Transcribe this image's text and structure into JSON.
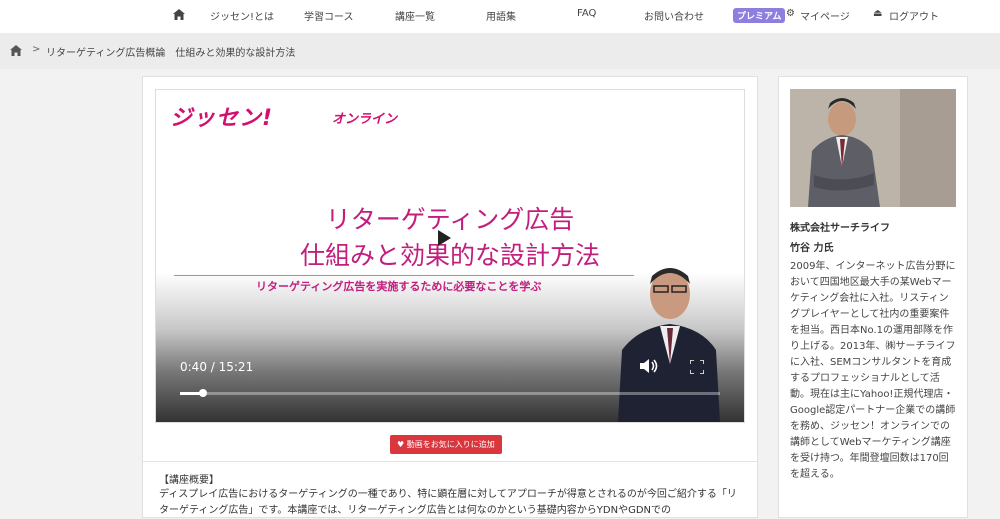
{
  "nav": {
    "items": [
      "ジッセン!とは",
      "学習コース",
      "講座一覧",
      "用語集",
      "FAQ",
      "お問い合わせ"
    ],
    "premium_badge": "プレミアム",
    "mypage": "マイページ",
    "logout": "ログアウト"
  },
  "breadcrumb": {
    "separator": ">",
    "current": "リターゲティング広告概論　仕組みと効果的な設計方法"
  },
  "video": {
    "logo": "ジッセン!",
    "logo_sub": "オンライン",
    "title_line1": "リターゲティング広告",
    "title_line2": "仕組みと効果的な設計方法",
    "subtitle": "リターゲティング広告を実施するために必要なことを学ぶ",
    "time": "0:40 / 15:21",
    "progress": 0.043
  },
  "favorite_button": "動画をお気に入りに追加",
  "overview": {
    "heading": "【講座概要】",
    "text": "ディスプレイ広告におけるターゲティングの一種であり、特に顕在層に対してアプローチが得意とされるのが今回ご紹介する「リターゲティング広告」です。本講座では、リターゲティング広告とは何なのかという基礎内容からYDNやGDNでの"
  },
  "instructor": {
    "company": "株式会社サーチライフ",
    "name": "竹谷 力氏",
    "bio": "2009年、インターネット広告分野において四国地区最大手の某Webマーケティング会社に入社。リスティングプレイヤーとして社内の重要案件を担当。西日本No.1の運用部隊を作り上げる。2013年、㈱サーチライフに入社、SEMコンサルタントを育成するプロフェッショナルとして活動。現在は主にYahoo!正規代理店・Google認定パートナー企業での講師を務め、ジッセン！オンラインでの講師としてWebマーケティング講座を受け持つ。年間登壇回数は170回を超える。"
  },
  "colors": {
    "accent": "#c21e7d",
    "premium": "#8c7fe0",
    "favorite": "#d9363e"
  }
}
